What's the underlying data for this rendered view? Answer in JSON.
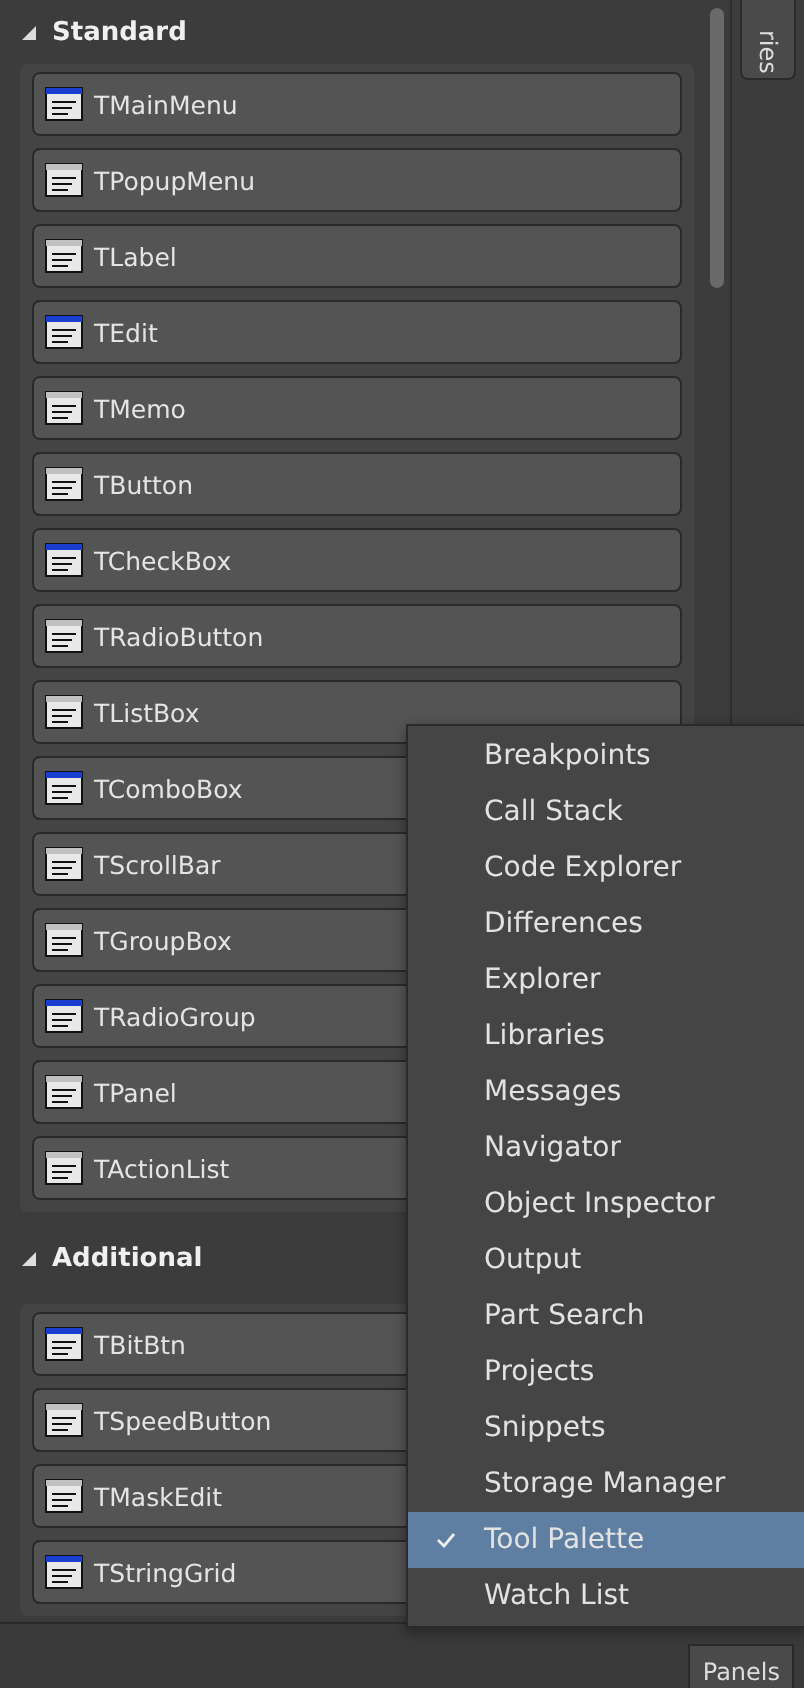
{
  "side_tab": {
    "label": "ries"
  },
  "sections": [
    {
      "title": "Standard",
      "expanded": true,
      "items": [
        "TMainMenu",
        "TPopupMenu",
        "TLabel",
        "TEdit",
        "TMemo",
        "TButton",
        "TCheckBox",
        "TRadioButton",
        "TListBox",
        "TComboBox",
        "TScrollBar",
        "TGroupBox",
        "TRadioGroup",
        "TPanel",
        "TActionList"
      ]
    },
    {
      "title": "Additional",
      "expanded": true,
      "items": [
        "TBitBtn",
        "TSpeedButton",
        "TMaskEdit",
        "TStringGrid"
      ]
    }
  ],
  "context_menu": [
    {
      "label": "Breakpoints",
      "checked": false,
      "selected": false
    },
    {
      "label": "Call Stack",
      "checked": false,
      "selected": false
    },
    {
      "label": "Code Explorer",
      "checked": false,
      "selected": false
    },
    {
      "label": "Differences",
      "checked": false,
      "selected": false
    },
    {
      "label": "Explorer",
      "checked": false,
      "selected": false
    },
    {
      "label": "Libraries",
      "checked": false,
      "selected": false
    },
    {
      "label": "Messages",
      "checked": false,
      "selected": false
    },
    {
      "label": "Navigator",
      "checked": false,
      "selected": false
    },
    {
      "label": "Object Inspector",
      "checked": false,
      "selected": false
    },
    {
      "label": "Output",
      "checked": false,
      "selected": false
    },
    {
      "label": "Part Search",
      "checked": false,
      "selected": false
    },
    {
      "label": "Projects",
      "checked": false,
      "selected": false
    },
    {
      "label": "Snippets",
      "checked": false,
      "selected": false
    },
    {
      "label": "Storage Manager",
      "checked": false,
      "selected": false
    },
    {
      "label": "Tool Palette",
      "checked": true,
      "selected": true
    },
    {
      "label": "Watch List",
      "checked": false,
      "selected": false
    }
  ],
  "bottom_button": {
    "label": "Panels"
  }
}
